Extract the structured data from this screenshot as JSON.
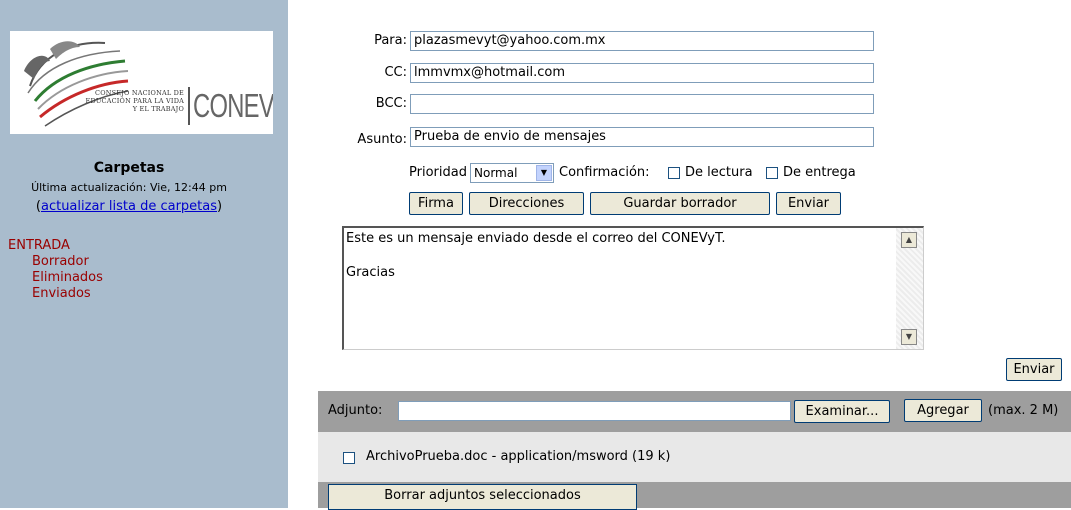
{
  "sidebar": {
    "logo_text": "CONSEJO NACIONAL DE EDUCACIÓN PARA LA VIDA Y EL TRABAJO",
    "logo_brand": "CONEVyT",
    "carpetas_title": "Carpetas",
    "last_update": "Última actualización: Vie, 12:44 pm",
    "refresh_open": "(",
    "refresh_link": "actualizar lista de carpetas",
    "refresh_close": ")",
    "folders": {
      "inbox": "ENTRADA",
      "drafts": "Borrador",
      "deleted": "Eliminados",
      "sent": "Enviados"
    }
  },
  "compose": {
    "to_label": "Para:",
    "to_value": "plazasmevyt@yahoo.com.mx",
    "cc_label": "CC:",
    "cc_value": "lmmvmx@hotmail.com",
    "bcc_label": "BCC:",
    "bcc_value": "",
    "subject_label": "Asunto:",
    "subject_value": "Prueba de envio de mensajes",
    "priority_label": "Prioridad",
    "priority_value": "Normal",
    "confirm_label": "Confirmación:",
    "read_receipt_label": "De lectura",
    "delivery_receipt_label": "De entrega",
    "buttons": {
      "signature": "Firma",
      "addresses": "Direcciones",
      "save_draft": "Guardar borrador",
      "send_top": "Enviar",
      "send_bottom": "Enviar"
    },
    "body": "Este es un mensaje enviado desde el correo del CONEVyT.\n\nGracias"
  },
  "attachments": {
    "label": "Adjunto:",
    "file_value": "",
    "browse": "Examinar...",
    "add": "Agregar",
    "max_size": "(max. 2 M)",
    "file_item": "ArchivoPrueba.doc - application/msword (19 k)",
    "delete_selected": "Borrar adjuntos seleccionados"
  }
}
